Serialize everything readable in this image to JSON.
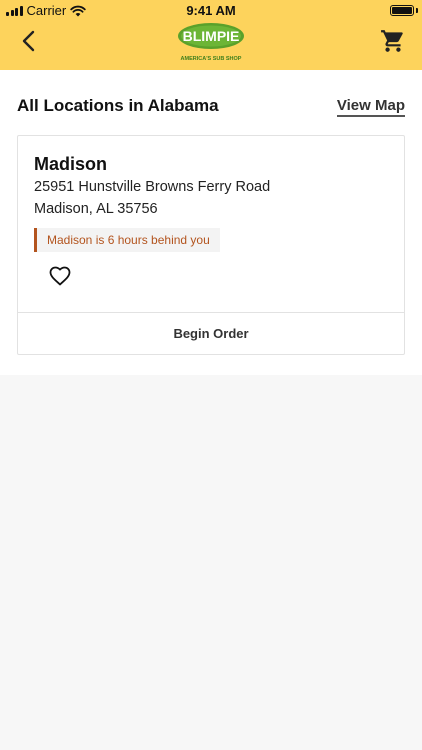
{
  "status_bar": {
    "carrier": "Carrier",
    "time": "9:41 AM"
  },
  "header": {
    "logo_text": "BLIMPIE",
    "logo_tagline": "AMERICA'S SUB SHOP",
    "brand_color": "#fdd35c",
    "logo_green": "#5aa12b"
  },
  "page": {
    "section_title": "All Locations in Alabama",
    "view_map_label": "View Map"
  },
  "location": {
    "name": "Madison",
    "address_line1": "25951 Hunstville Browns Ferry Road",
    "address_line2": "Madison, AL 35756",
    "timezone_note": "Madison is 6 hours behind you",
    "favorite_icon": "heart-outline-icon",
    "begin_order_label": "Begin Order"
  },
  "colors": {
    "accent_warning": "#b3541e",
    "background": "#f7f7f7"
  }
}
